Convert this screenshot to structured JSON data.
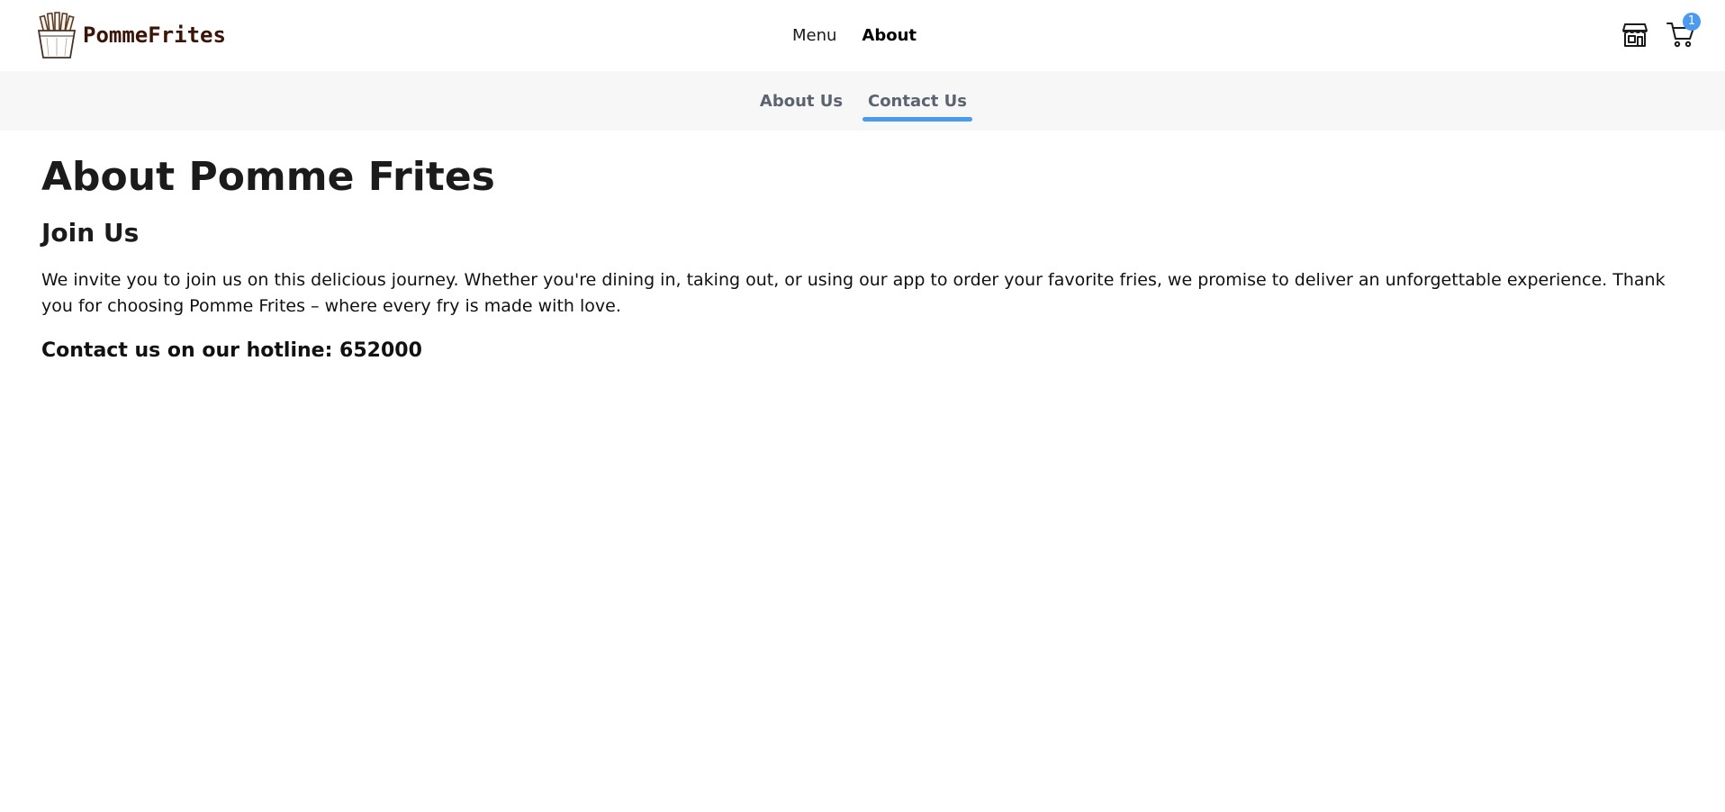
{
  "brand": {
    "name": "PommeFrites",
    "logo_icon": "fries-icon",
    "name_color": "#3b1408"
  },
  "main_nav": {
    "items": [
      {
        "label": "Menu",
        "active": false
      },
      {
        "label": "About",
        "active": true
      }
    ]
  },
  "header_actions": {
    "store_icon": "store-icon",
    "cart_icon": "cart-icon",
    "cart_count": "1",
    "badge_color": "#4a9bf0"
  },
  "sub_nav": {
    "tabs": [
      {
        "label": "About Us",
        "active": false
      },
      {
        "label": "Contact Us",
        "active": true
      }
    ],
    "accent": "#4a9bf0"
  },
  "content": {
    "title": "About Pomme Frites",
    "section_title": "Join Us",
    "body": "We invite you to join us on this delicious journey. Whether you're dining in, taking out, or using our app to order your favorite fries, we promise to deliver an unforgettable experience. Thank you for choosing Pomme Frites – where every fry is made with love.",
    "hotline": "Contact us on our hotline: 652000"
  }
}
